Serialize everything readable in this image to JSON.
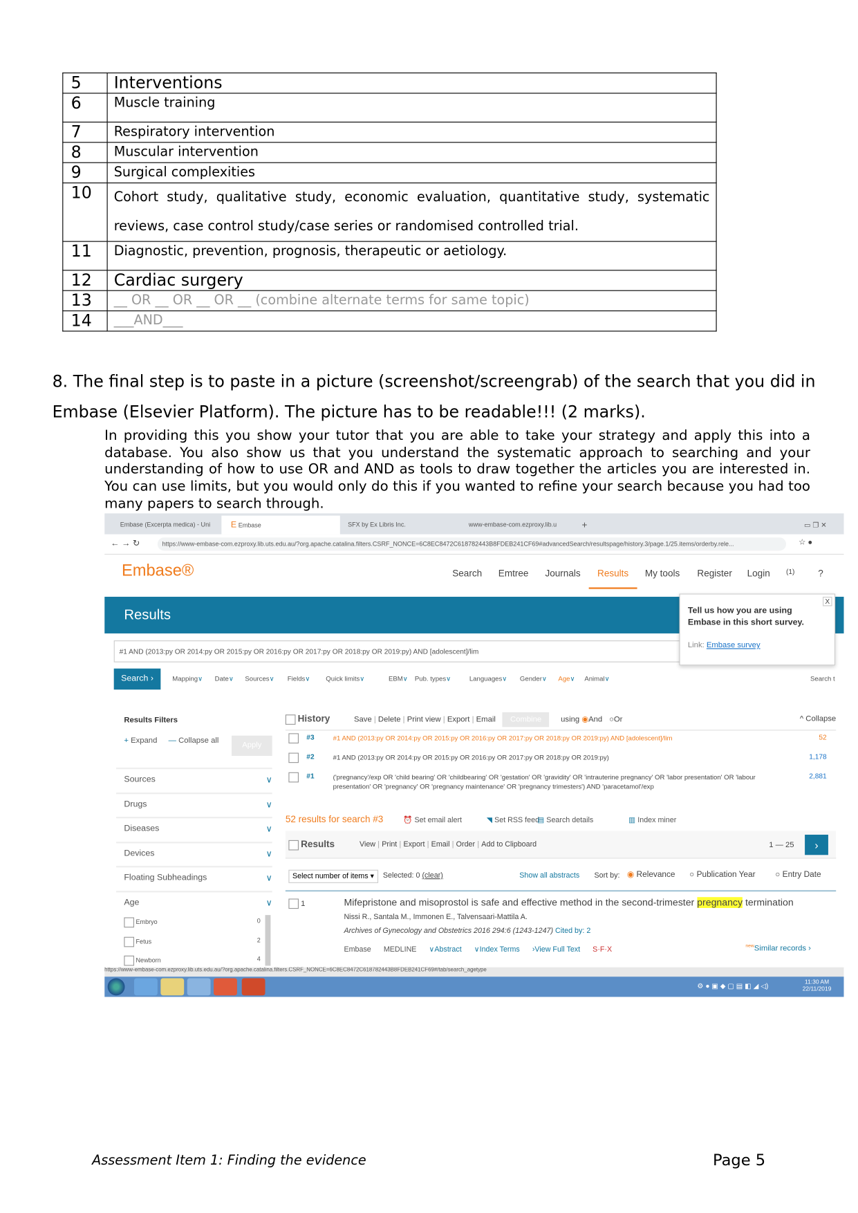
{
  "table": [
    {
      "n": "5",
      "text": "Interventions",
      "style": "big"
    },
    {
      "n": "6",
      "text": "Muscle training"
    },
    {
      "n": "7",
      "text": "Respiratory intervention"
    },
    {
      "n": "8",
      "text": "Muscular intervention"
    },
    {
      "n": "9",
      "text": "Surgical complexities"
    },
    {
      "n": "10",
      "text": "Cohort study, qualitative study, economic evaluation, quantitative study, systematic reviews, case control study/case series or randomised controlled trial."
    },
    {
      "n": "11",
      "text": "Diagnostic, prevention, prognosis, therapeutic or aetiology."
    },
    {
      "n": "12",
      "text": "Cardiac surgery",
      "style": "big"
    },
    {
      "n": "13",
      "text": "__ OR __ OR __ OR __ (combine alternate terms for same topic)",
      "style": "grey"
    },
    {
      "n": "14",
      "text": "___AND___",
      "style": "grey"
    }
  ],
  "step8": "8. The final step is to paste in a picture (screenshot/screengrab) of the search that you did in Embase (Elsevier Platform). The picture has to be readable!!! (2 marks).",
  "paragraph": "In providing this you show your tutor that you are able to take your strategy and apply this into a database. You also show us that you understand the systematic approach to searching and your understanding of how to use OR and AND as tools to draw together the articles you are interested in. You can use limits, but you would only do this if you wanted to refine your search because you had too many papers to search through.",
  "screenshot": {
    "tabs": [
      "Embase (Excerpta medica) - Uni",
      "Embase",
      "SFX by Ex Libris Inc.",
      "www-embase-com.ezproxy.lib.u"
    ],
    "url": "https://www-embase-com.ezproxy.lib.uts.edu.au/?org.apache.catalina.filters.CSRF_NONCE=6C8EC8472C618782443B8FDEB241CF69#advancedSearch/resultspage/history.3/page.1/25.items/orderby.rele...",
    "logo": "Embase®",
    "nav": [
      "Search",
      "Emtree",
      "Journals",
      "Results",
      "My tools",
      "Register",
      "Login",
      "(1)"
    ],
    "band_title": "Results",
    "query": "#1 AND (2013:py OR 2014:py OR 2015:py OR 2016:py OR 2017:py OR 2018:py OR 2019:py) AND [adolescent]/lim",
    "survey": {
      "text": "Tell us how you are using Embase in this short survey.",
      "link_label": "Link:",
      "link": "Embase survey"
    },
    "search_btn": "Search",
    "limits": [
      "Mapping",
      "Date",
      "Sources",
      "Fields",
      "Quick limits",
      "EBM",
      "Pub. types",
      "Languages",
      "Gender",
      "Age",
      "Animal"
    ],
    "search_tips": "Search t",
    "filters_title": "Results Filters",
    "expand": "Expand",
    "collapse_all": "Collapse all",
    "apply": "Apply",
    "filters": [
      "Sources",
      "Drugs",
      "Diseases",
      "Devices",
      "Floating Subheadings",
      "Age"
    ],
    "age_items": [
      {
        "label": "Embryo",
        "count": "0"
      },
      {
        "label": "Fetus",
        "count": "2"
      },
      {
        "label": "Newborn",
        "count": "4"
      }
    ],
    "history_label": "History",
    "history_actions": [
      "Save",
      "Delete",
      "Print view",
      "Export",
      "Email"
    ],
    "combine": "Combine",
    "using": "using",
    "and": "And",
    "or": "Or",
    "collapse": "Collapse",
    "history": [
      {
        "id": "#3",
        "query": "#1 AND (2013:py OR 2014:py OR 2015:py OR 2016:py OR 2017:py OR 2018:py OR 2019:py) AND [adolescent]/lim",
        "count": "52"
      },
      {
        "id": "#2",
        "query": "#1 AND (2013:py OR 2014:py OR 2015:py OR 2016:py OR 2017:py OR 2018:py OR 2019:py)",
        "count": "1,178"
      },
      {
        "id": "#1",
        "query": "('pregnancy'/exp OR 'child bearing' OR 'childbearing' OR 'gestation' OR 'gravidity' OR 'intrauterine pregnancy' OR 'labor presentation' OR 'labour presentation' OR 'pregnancy' OR 'pregnancy maintenance' OR 'pregnancy trimesters') AND 'paracetamol'/exp",
        "count": "2,881"
      }
    ],
    "results_for": "52 results for search #3",
    "result_actions": [
      "Set email alert",
      "Set RSS feed",
      "Search details",
      "Index miner"
    ],
    "new": "new",
    "results_label": "Results",
    "results_actions": [
      "View",
      "Print",
      "Export",
      "Email",
      "Order",
      "Add to Clipboard"
    ],
    "range": "1 — 25",
    "select_items": "Select number of items",
    "selected": "Selected: 0",
    "clear": "(clear)",
    "show_abstracts": "Show all abstracts",
    "sort_by": "Sort by:",
    "sort": [
      "Relevance",
      "Publication Year",
      "Entry Date"
    ],
    "record": {
      "num": "1",
      "title_a": "Mifepristone and misoprostol is safe and effective method in the second-trimester ",
      "title_hl": "pregnancy",
      "title_b": " termination",
      "authors": "Nissi R., Santala M., Immonen E., Talvensaari-Mattila A.",
      "journal": "Archives of Gynecology and Obstetrics 2016 294:6 (1243-1247)",
      "cited": "Cited by: 2",
      "links": [
        "Embase",
        "MEDLINE",
        "Abstract",
        "Index Terms",
        "View Full Text",
        "S·F·X",
        "Similar records"
      ]
    },
    "status_url": "https://www-embase-com.ezproxy.lib.uts.edu.au/?org.apache.catalina.filters.CSRF_NONCE=6C8EC8472C618782443B8FDEB241CF69#/tab/search_agetype",
    "clock": {
      "time": "11:30 AM",
      "date": "22/11/2019"
    }
  },
  "footer": {
    "left": "Assessment Item 1: Finding the evidence",
    "right": "Page 5"
  },
  "colors": {
    "embase_orange": "#f07c1e",
    "embase_blue": "#1478a0",
    "link_blue": "#1a73c8",
    "highlight": "#ffff33"
  }
}
